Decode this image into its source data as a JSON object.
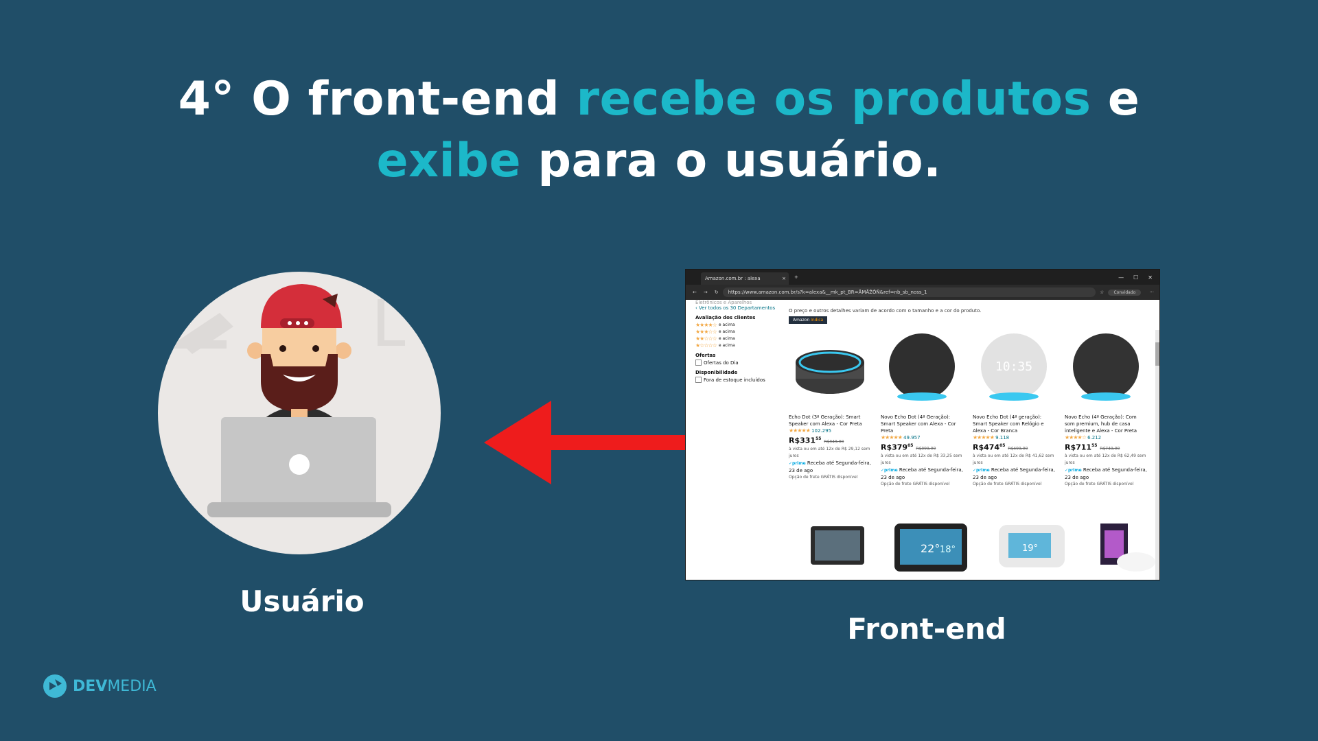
{
  "heading": {
    "line1_a": "4° O front-end ",
    "line1_accent": "recebe os produtos",
    "line1_b": " e",
    "line2_accent": "exibe",
    "line2_b": " para o usuário."
  },
  "labels": {
    "user": "Usuário",
    "frontend": "Front-end"
  },
  "logo": {
    "dev": "DEV",
    "media": "MEDIA"
  },
  "browser": {
    "tab_title": "Amazon.com.br : alexa",
    "tab_close": "×",
    "new_tab": "+",
    "window_controls": [
      "—",
      "☐",
      "✕"
    ],
    "url": "https://www.amazon.com.br/s?k=alexa&__mk_pt_BR=ÅMÅŽÕÑ&ref=nb_sb_noss_1",
    "guest_label": "Convidado",
    "menu": "···",
    "sidebar": {
      "cut_text": "Eletrônicos e Aparelhos",
      "see_all": "‹ Ver todos os 30 Departamentos",
      "reviews_title": "Avaliação dos clientes",
      "ratings": [
        {
          "stars": "★★★★☆",
          "label": "e acima"
        },
        {
          "stars": "★★★☆☆",
          "label": "e acima"
        },
        {
          "stars": "★★☆☆☆",
          "label": "e acima"
        },
        {
          "stars": "★☆☆☆☆",
          "label": "e acima"
        }
      ],
      "offers_title": "Ofertas",
      "offers_item": "Ofertas do Dia",
      "avail_title": "Disponibilidade",
      "avail_item": "Fora de estoque incluídos"
    },
    "notice": "O preço e outros detalhes variam de acordo com o tamanho e a cor do produto.",
    "badge_a": "Amazon ",
    "badge_b": "Indica",
    "products": [
      {
        "name": "Echo Dot (3ª Geração): Smart Speaker com Alexa - Cor Preta",
        "stars": "★★★★★",
        "reviews": "102.295",
        "price": "R$331",
        "cents": "55",
        "old": "R$349,00",
        "install": "à vista ou em até 12x de R$ 29,12 sem juros",
        "prime": "✓prime",
        "delivery": "Receba até Segunda-feira, 23 de ago",
        "shipping": "Opção de frete GRÁTIS disponível"
      },
      {
        "name": "Novo Echo Dot (4ª Geração): Smart Speaker com Alexa - Cor Preta",
        "stars": "★★★★★",
        "reviews": "49.957",
        "price": "R$379",
        "cents": "05",
        "old": "R$399,00",
        "install": "à vista ou em até 12x de R$ 33,25 sem juros",
        "prime": "✓prime",
        "delivery": "Receba até Segunda-feira, 23 de ago",
        "shipping": "Opção de frete GRÁTIS disponível"
      },
      {
        "name": "Novo Echo Dot (4ª geração): Smart Speaker com Relógio e Alexa - Cor Branca",
        "stars": "★★★★★",
        "reviews": "9.118",
        "price": "R$474",
        "cents": "05",
        "old": "R$499,00",
        "install": "à vista ou em até 12x de R$ 41,62 sem juros",
        "prime": "✓prime",
        "delivery": "Receba até Segunda-feira, 23 de ago",
        "shipping": "Opção de frete GRÁTIS disponível"
      },
      {
        "name": "Novo Echo (4ª Geração): Com som premium, hub de casa inteligente e Alexa - Cor Preta",
        "stars": "★★★★☆",
        "reviews": "6.212",
        "price": "R$711",
        "cents": "55",
        "old": "R$749,00",
        "install": "à vista ou em até 12x de R$ 62,49 sem juros",
        "prime": "✓prime",
        "delivery": "Receba até Segunda-feira, 23 de ago",
        "shipping": "Opção de frete GRÁTIS disponível"
      }
    ],
    "second_row": {
      "temp1": "22°",
      "temp2": "18°",
      "temp3": "19°"
    },
    "clock_display": "10:35"
  },
  "colors": {
    "background": "#204e68",
    "accent": "#1cb8c9",
    "arrow": "#ee1c1c"
  },
  "icons": [
    "user-avatar-icon",
    "arrow-left-icon",
    "devmedia-logo-icon"
  ]
}
